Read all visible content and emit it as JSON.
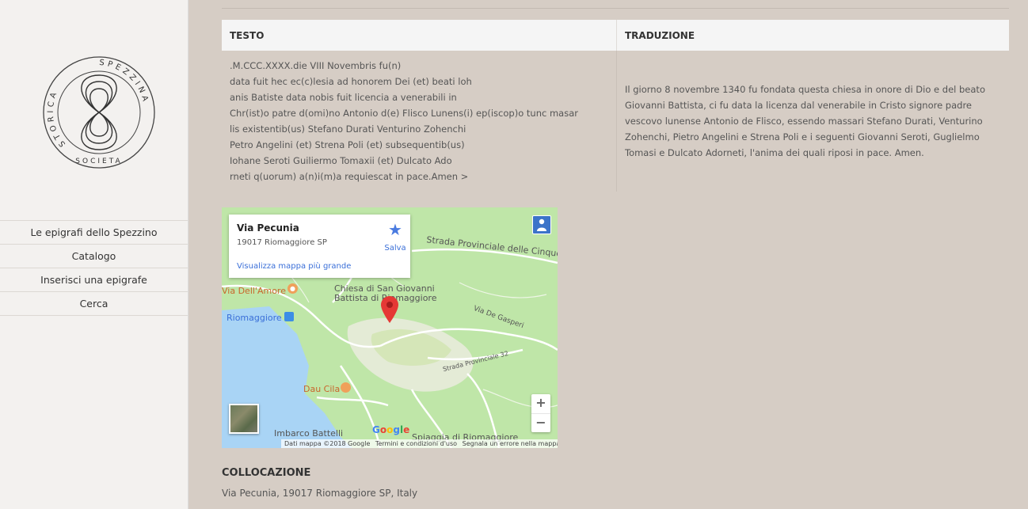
{
  "sidebar": {
    "logo_text": [
      "SPEZZINA",
      "SOCIETA",
      "STORICA"
    ],
    "nav": [
      "Le epigrafi dello Spezzino",
      "Catalogo",
      "Inserisci una epigrafe",
      "Cerca"
    ]
  },
  "table": {
    "headers": {
      "testo": "TESTO",
      "traduzione": "TRADUZIONE"
    },
    "testo_lines": [
      ".M.CCC.XXXX.die VIII Novembris fu(n)",
      "data fuit hec ec(c)lesia ad honorem Dei (et) beati loh",
      "anis Batiste data nobis fuit licencia a venerabili in",
      "Chr(ist)o patre d(omi)no Antonio d(e) Flisco Lunens(i) ep(iscop)o tunc masar",
      "lis existentib(us) Stefano Durati Venturino Zohenchi",
      "Petro Angelini (et) Strena Poli (et) subsequentib(us)",
      "Iohane Seroti Guiliermo Tomaxii (et) Dulcato Ado",
      "rneti q(uorum) a(n)i(m)a requiescat in pace.Amen >"
    ],
    "traduzione_lines": [
      "Il giorno 8 novembre 1340 fu fondata questa chiesa in onore di Dio e del beato",
      "Giovanni Battista, ci fu data la licenza dal venerabile in Cristo signore padre",
      "vescovo lunense Antonio de Flisco, essendo massari Stefano Durati, Venturino",
      "Zohenchi, Pietro Angelini e Strena Poli e i seguenti Giovanni Seroti, Guglielmo",
      "Tomasi e Dulcato Adorneti, l'anima dei quali riposi in pace. Amen."
    ]
  },
  "map": {
    "card": {
      "title": "Via Pecunia",
      "address": "19017 Riomaggiore SP",
      "link": "Visualizza mappa più grande",
      "save": "Salva"
    },
    "labels": {
      "strada": "Strada Provinciale delle Cinque Te",
      "via_amore": "Via Dell'Amore",
      "chiesa_1": "Chiesa di San Giovanni",
      "chiesa_2": "Battista di Riomaggiore",
      "riomaggiore": "Riomaggiore",
      "via_gasperi": "Via De Gasperi",
      "sp32": "Strada Provinciale 32",
      "dau_cila": "Dau Cila",
      "imbarco": "Imbarco Battelli",
      "spiaggia": "Spiaggia di Riomaggiore"
    },
    "google": [
      "G",
      "o",
      "o",
      "g",
      "l",
      "e"
    ],
    "google_colors": [
      "#4285f4",
      "#ea4335",
      "#fbbc05",
      "#4285f4",
      "#34a853",
      "#ea4335"
    ],
    "zoom_in": "+",
    "zoom_out": "−",
    "footer": {
      "data": "Dati mappa ©2018 Google",
      "terms": "Termini e condizioni d'uso",
      "report": "Segnala un errore nella mappa"
    }
  },
  "collocazione": {
    "heading": "COLLOCAZIONE",
    "text": "Via Pecunia, 19017 Riomaggiore SP, Italy"
  }
}
